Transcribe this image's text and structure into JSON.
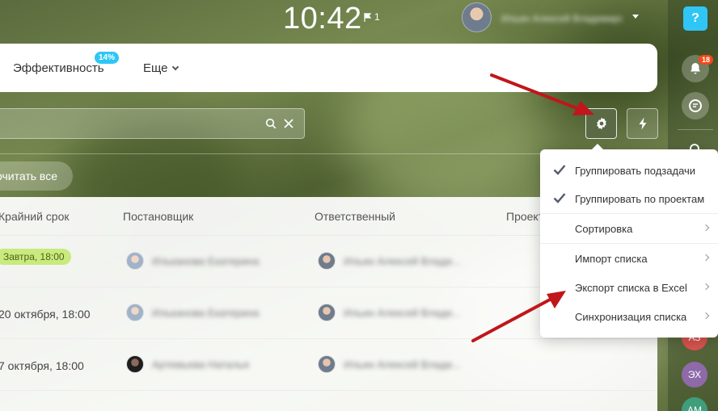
{
  "topbar": {
    "time": "10:42",
    "flag_count": "1",
    "user_name": "Ильин Алексей Владимирович"
  },
  "right_panel": {
    "help": "?",
    "notifications_badge": "18",
    "mini_avatars": [
      "АЗ",
      "ЭХ",
      "АМ"
    ]
  },
  "nav": {
    "items": [
      {
        "label": "Эффективность",
        "badge": "14%"
      },
      {
        "label": "Еще"
      }
    ]
  },
  "toolbar": {
    "read_all": "очитать все"
  },
  "table": {
    "headers": [
      "Крайний срок",
      "Постановщик",
      "Ответственный",
      "Проект"
    ],
    "rows": [
      {
        "deadline": "Завтра, 18:00",
        "creator": "Ильканова Екатерина",
        "responsible": "Ильин Алексей Влади..."
      },
      {
        "deadline": "20 октября, 18:00",
        "creator": "Ильканова Екатерина",
        "responsible": "Ильин Алексей Влади..."
      },
      {
        "deadline": "7 октября, 18:00",
        "creator": "Артемьева Наталья",
        "responsible": "Ильин Алексей Влади..."
      }
    ]
  },
  "menu": {
    "items": [
      {
        "label": "Группировать подзадачи",
        "checked": true,
        "submenu": false
      },
      {
        "label": "Группировать по проектам",
        "checked": true,
        "submenu": false
      },
      {
        "label": "Сортировка",
        "checked": false,
        "submenu": true
      },
      {
        "label": "Импорт списка",
        "checked": false,
        "submenu": true
      },
      {
        "label": "Экспорт списка в Excel",
        "checked": false,
        "submenu": true
      },
      {
        "label": "Синхронизация списка",
        "checked": false,
        "submenu": true
      }
    ]
  },
  "colors": {
    "accent": "#2fc6f6",
    "deadline_chip": "#c9ea7e",
    "annotation_arrow": "#c0161c",
    "badge": "#f54819"
  }
}
